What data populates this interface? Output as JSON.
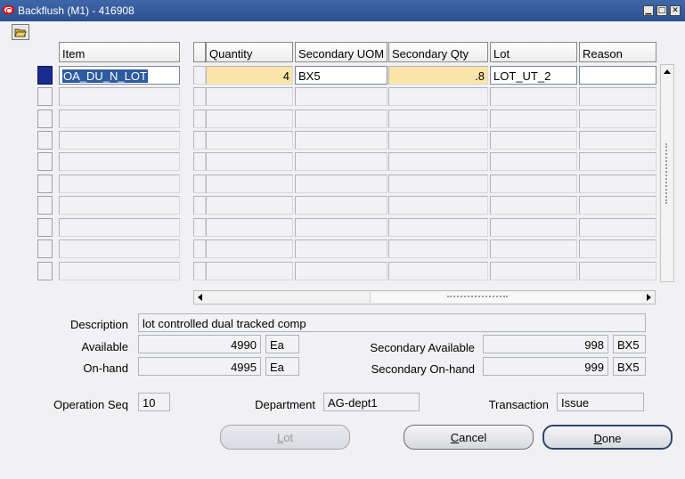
{
  "window": {
    "title": "Backflush (M1) - 416908"
  },
  "columns": {
    "item": "Item",
    "quantity": "Quantity",
    "secondary_uom": "Secondary UOM",
    "secondary_qty": "Secondary Qty",
    "lot": "Lot",
    "reason": "Reason"
  },
  "row1": {
    "item": "OA_DU_N_LOT",
    "quantity": "4",
    "secondary_uom": "BX5",
    "secondary_qty": ".8",
    "lot": "LOT_UT_2",
    "reason": ""
  },
  "details": {
    "description_label": "Description",
    "description_value": "lot controlled dual tracked comp",
    "available_label": "Available",
    "available_value": "4990",
    "available_uom": "Ea",
    "onhand_label": "On-hand",
    "onhand_value": "4995",
    "onhand_uom": "Ea",
    "sec_available_label": "Secondary Available",
    "sec_available_value": "998",
    "sec_available_uom": "BX5",
    "sec_onhand_label": "Secondary On-hand",
    "sec_onhand_value": "999",
    "sec_onhand_uom": "BX5",
    "opseq_label": "Operation Seq",
    "opseq_value": "10",
    "department_label": "Department",
    "department_value": "AG-dept1",
    "transaction_label": "Transaction",
    "transaction_value": "Issue"
  },
  "buttons": {
    "lot_first": "L",
    "lot_rest": "ot",
    "cancel_first": "C",
    "cancel_rest": "ancel",
    "done_first": "D",
    "done_rest": "one"
  },
  "icons": {
    "toolbar": "folder-open-icon",
    "scroll_up": "arrow-up-icon",
    "scroll_left": "arrow-left-icon",
    "scroll_right": "arrow-right-icon"
  },
  "colors": {
    "titlebar": "#2b5090",
    "required_field": "#fbe5a8",
    "selected_row_indicator": "#1b2c90"
  }
}
